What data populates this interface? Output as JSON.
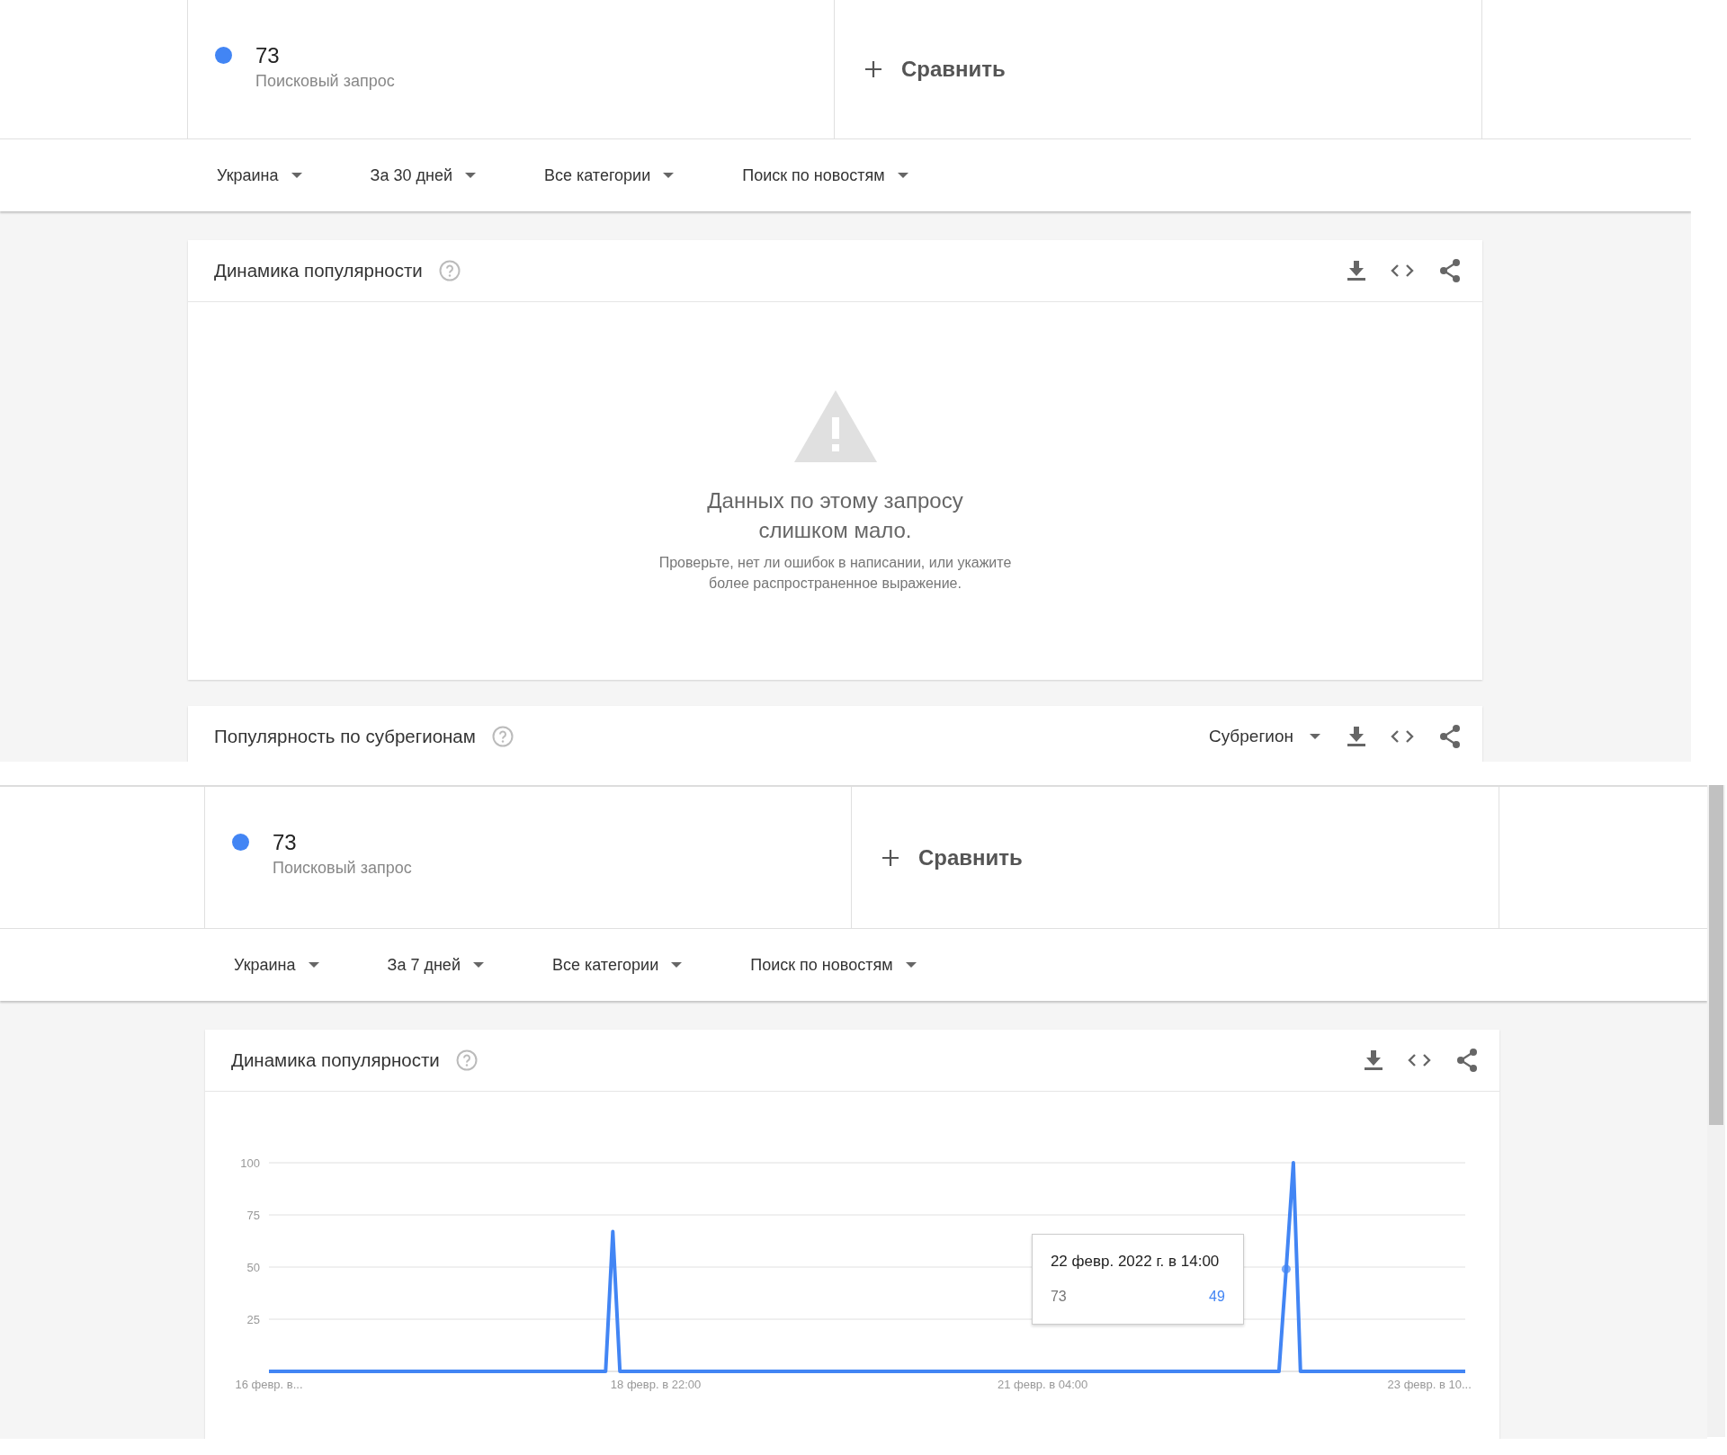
{
  "screenshots": [
    {
      "term": {
        "value": "73",
        "label": "Поисковый запрос"
      },
      "compare": {
        "label": "Сравнить"
      },
      "filters": [
        "Украина",
        "За 30 дней",
        "Все категории",
        "Поиск по новостям"
      ],
      "cards": [
        {
          "kind": "empty",
          "title": "Динамика популярности",
          "message_title": "Данных по этому запросу слишком мало.",
          "message_body": "Проверьте, нет ли ошибок в написании, или укажите более распространенное выражение."
        },
        {
          "kind": "header",
          "title": "Популярность по субрегионам",
          "dropdown": "Субрегион"
        }
      ]
    },
    {
      "term": {
        "value": "73",
        "label": "Поисковый запрос"
      },
      "compare": {
        "label": "Сравнить"
      },
      "filters": [
        "Украина",
        "За 7 дней",
        "Все категории",
        "Поиск по новостям"
      ],
      "cards": [
        {
          "kind": "chart",
          "title": "Динамика популярности",
          "tooltip": {
            "title": "22 февр. 2022 г. в 14:00",
            "value": "49"
          },
          "chart_data": {
            "type": "line",
            "grid": true,
            "categories": [
              "16 февр. в...",
              null,
              null,
              null,
              null,
              null,
              null,
              null,
              null,
              null,
              null,
              null,
              null,
              null,
              null,
              null,
              null,
              null,
              null,
              null,
              null,
              null,
              null,
              null,
              null,
              null,
              null,
              null,
              null,
              null,
              null,
              null,
              null,
              null,
              null,
              null,
              null,
              null,
              null,
              null,
              null,
              null,
              null,
              null,
              null,
              null,
              null,
              null,
              null,
              null,
              null,
              null,
              null,
              null,
              "18 февр. в 22:00",
              null,
              null,
              null,
              null,
              null,
              null,
              null,
              null,
              null,
              null,
              null,
              null,
              null,
              null,
              null,
              null,
              null,
              null,
              null,
              null,
              null,
              null,
              null,
              null,
              null,
              null,
              null,
              null,
              null,
              null,
              null,
              null,
              null,
              null,
              null,
              null,
              null,
              null,
              null,
              null,
              null,
              null,
              null,
              null,
              null,
              null,
              null,
              null,
              null,
              null,
              null,
              null,
              null,
              "21 февр. в 04:00",
              null,
              null,
              null,
              null,
              null,
              null,
              null,
              null,
              null,
              null,
              null,
              null,
              null,
              null,
              null,
              null,
              null,
              null,
              null,
              null,
              null,
              null,
              null,
              null,
              null,
              null,
              null,
              null,
              null,
              null,
              null,
              null,
              null,
              null,
              null,
              null,
              null,
              null,
              null,
              null,
              null,
              null,
              null,
              null,
              null,
              null,
              null,
              null,
              null,
              null,
              null,
              null,
              null,
              "23 февр. в 10...",
              null,
              null,
              null,
              null,
              null
            ],
            "ylim": [
              0,
              100
            ],
            "yticks": [
              25,
              50,
              75,
              100
            ],
            "series": [
              {
                "name": "73",
                "color": "#4285f4",
                "values": [
                  0,
                  0,
                  0,
                  0,
                  0,
                  0,
                  0,
                  0,
                  0,
                  0,
                  0,
                  0,
                  0,
                  0,
                  0,
                  0,
                  0,
                  0,
                  0,
                  0,
                  0,
                  0,
                  0,
                  0,
                  0,
                  0,
                  0,
                  0,
                  0,
                  0,
                  0,
                  0,
                  0,
                  0,
                  0,
                  0,
                  0,
                  0,
                  0,
                  0,
                  0,
                  0,
                  0,
                  0,
                  0,
                  0,
                  0,
                  0,
                  67,
                  0,
                  0,
                  0,
                  0,
                  0,
                  0,
                  0,
                  0,
                  0,
                  0,
                  0,
                  0,
                  0,
                  0,
                  0,
                  0,
                  0,
                  0,
                  0,
                  0,
                  0,
                  0,
                  0,
                  0,
                  0,
                  0,
                  0,
                  0,
                  0,
                  0,
                  0,
                  0,
                  0,
                  0,
                  0,
                  0,
                  0,
                  0,
                  0,
                  0,
                  0,
                  0,
                  0,
                  0,
                  0,
                  0,
                  0,
                  0,
                  0,
                  0,
                  0,
                  0,
                  0,
                  0,
                  0,
                  0,
                  0,
                  0,
                  0,
                  0,
                  0,
                  0,
                  0,
                  0,
                  0,
                  0,
                  0,
                  0,
                  0,
                  0,
                  0,
                  0,
                  0,
                  0,
                  0,
                  0,
                  0,
                  0,
                  0,
                  0,
                  0,
                  0,
                  0,
                  0,
                  0,
                  0,
                  0,
                  0,
                  0,
                  0,
                  0,
                  0,
                  0,
                  49,
                  100,
                  0,
                  0,
                  0,
                  0,
                  0,
                  0,
                  0,
                  0,
                  0,
                  0,
                  0,
                  0,
                  0,
                  0,
                  0,
                  0,
                  0,
                  0,
                  0,
                  0,
                  0,
                  0,
                  0,
                  0
                ]
              }
            ]
          }
        }
      ]
    }
  ]
}
